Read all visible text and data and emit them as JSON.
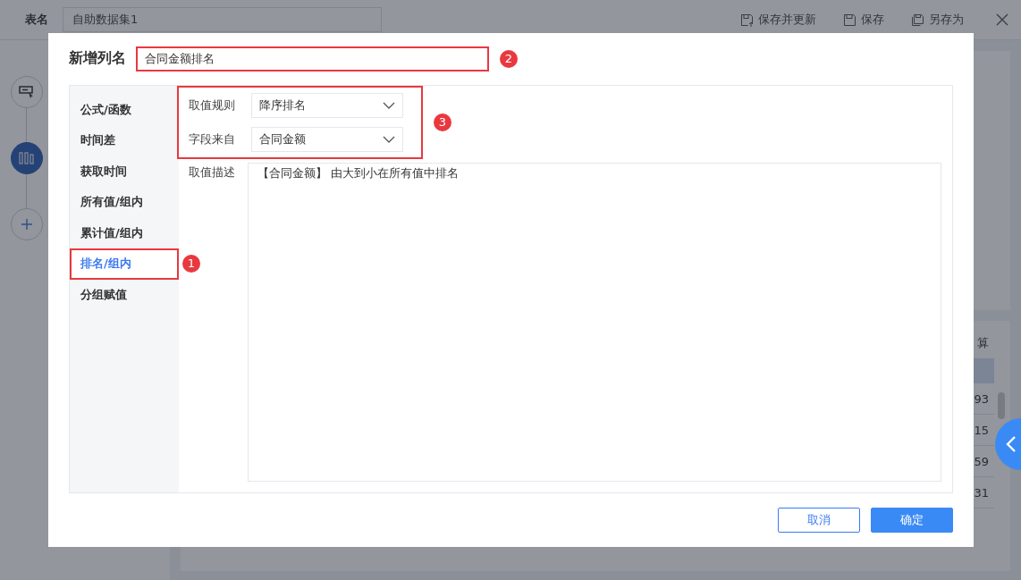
{
  "background": {
    "table_label": "表名",
    "table_name": "自助数据集1",
    "actions": [
      {
        "label": "保存并更新"
      },
      {
        "label": "保存"
      },
      {
        "label": "另存为"
      }
    ],
    "steps": [
      {
        "kind": "input",
        "selected": false
      },
      {
        "kind": "column",
        "selected": true
      },
      {
        "kind": "add",
        "selected": false
      }
    ],
    "column_header": "算",
    "cells": [
      "93",
      "15",
      "59",
      "31"
    ]
  },
  "dialog": {
    "title": "新增列名",
    "name_value": "合同金额排名",
    "name_highlighted": true,
    "name_badge": "2",
    "categories": [
      {
        "label": "公式/函数",
        "selected": false,
        "highlighted": false
      },
      {
        "label": "时间差",
        "selected": false,
        "highlighted": false
      },
      {
        "label": "获取时间",
        "selected": false,
        "highlighted": false
      },
      {
        "label": "所有值/组内",
        "selected": false,
        "highlighted": false
      },
      {
        "label": "累计值/组内",
        "selected": false,
        "highlighted": false
      },
      {
        "label": "排名/组内",
        "selected": true,
        "highlighted": true
      },
      {
        "label": "分组赋值",
        "selected": false,
        "highlighted": false
      }
    ],
    "category_badge": "1",
    "fields": [
      {
        "label": "取值规则",
        "value": "降序排名"
      },
      {
        "label": "字段来自",
        "value": "合同金额"
      }
    ],
    "fields_highlighted": true,
    "fields_badge": "3",
    "description_label": "取值描述",
    "description": "【合同金额】 由大到小在所有值中排名",
    "buttons": [
      {
        "label": "取消",
        "kind": "secondary"
      },
      {
        "label": "确定",
        "kind": "primary"
      }
    ]
  }
}
